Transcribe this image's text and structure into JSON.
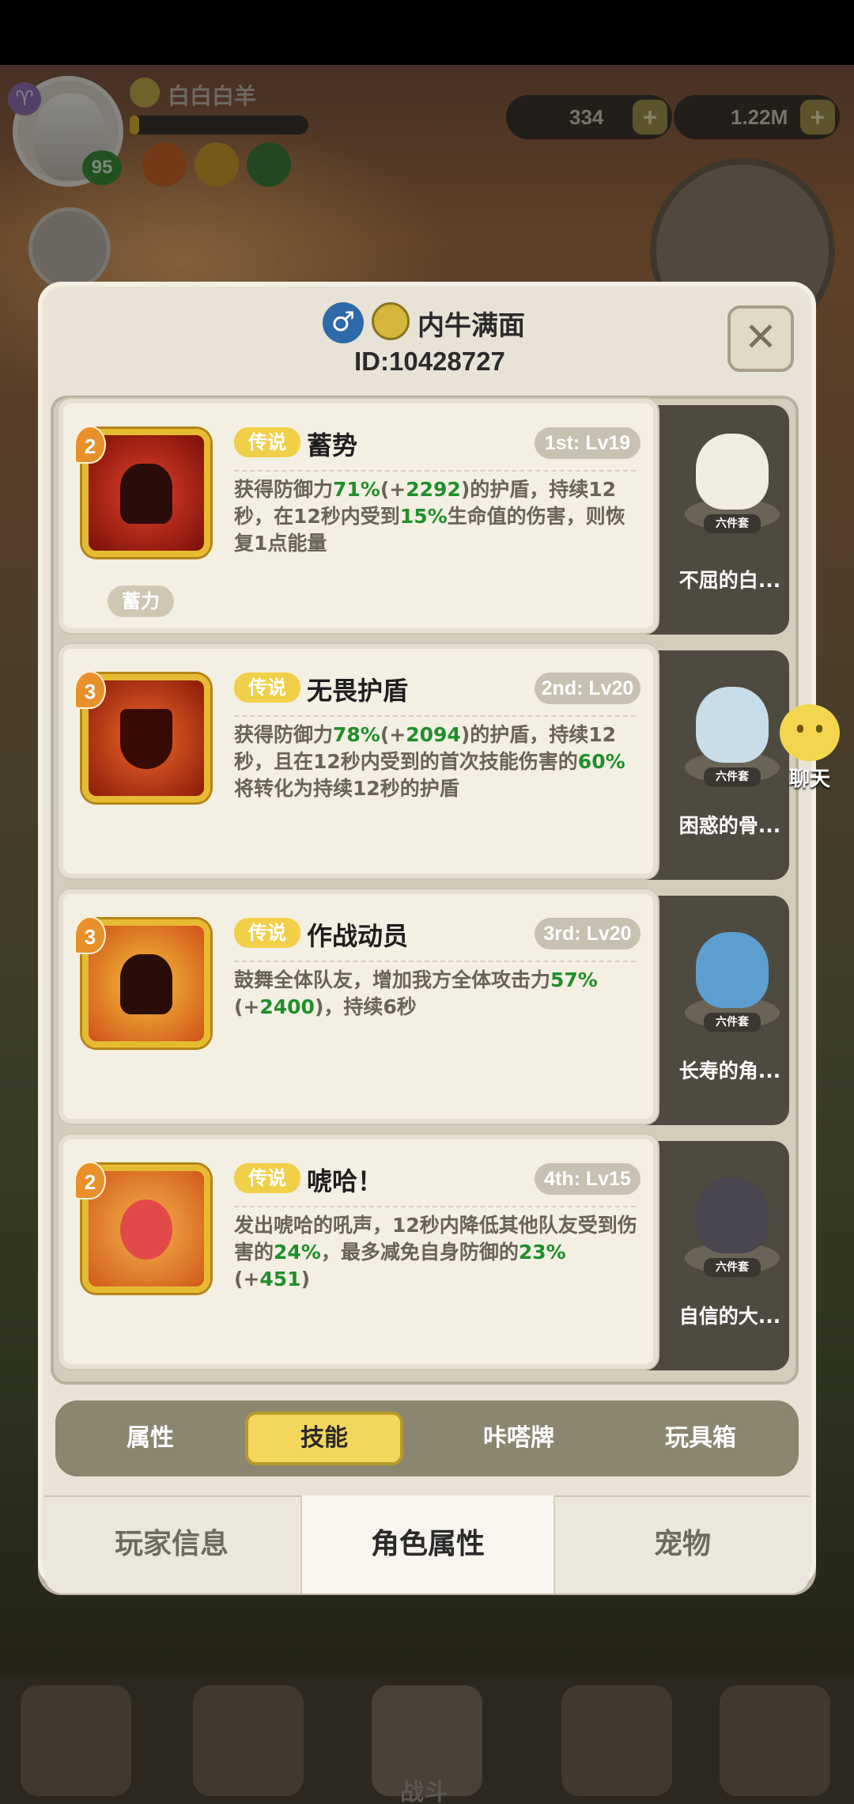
{
  "hud": {
    "player_name": "白白白羊",
    "level": "95",
    "currency1_value": "334",
    "currency2_value": "1.22M",
    "plus": "+"
  },
  "chat": {
    "label": "聊天"
  },
  "dialog": {
    "player_title": "内牛满面",
    "player_id": "ID:10428727",
    "gender_symbol": "♂",
    "close_glyph": "✕"
  },
  "skills": [
    {
      "rarity": "传说",
      "name": "蓄势",
      "slot": "1st: Lv19",
      "level_badge": "2",
      "tag": "蓄力",
      "desc_parts": [
        "获得防御力",
        "71%",
        "(+",
        "2292",
        ")的护盾，持续12秒，在12秒内受到",
        "15%",
        "生命值的伤害，则恢复1点能量"
      ]
    },
    {
      "rarity": "传说",
      "name": "无畏护盾",
      "slot": "2nd: Lv20",
      "level_badge": "3",
      "desc_parts": [
        "获得防御力",
        "78%",
        "(+",
        "2094",
        ")的护盾，持续12秒，且在12秒内受到的首次技能伤害的",
        "60%",
        "将转化为持续12秒的护盾"
      ]
    },
    {
      "rarity": "传说",
      "name": "作战动员",
      "slot": "3rd: Lv20",
      "level_badge": "3",
      "desc_parts": [
        "鼓舞全体队友，增加我方全体攻击力",
        "57%",
        "(+",
        "2400",
        ")，持续6秒"
      ]
    },
    {
      "rarity": "传说",
      "name": "唬哈！",
      "slot": "4th: Lv15",
      "level_badge": "2",
      "desc_parts": [
        "发出唬哈的吼声，12秒内降低其他队友受到伤害的",
        "24%",
        "，最多减免自身防御的",
        "23%",
        "(+",
        "451",
        ")"
      ]
    }
  ],
  "pets": [
    {
      "name": "不屈的白...",
      "badge": "六件套"
    },
    {
      "name": "困惑的骨...",
      "badge": "六件套"
    },
    {
      "name": "长寿的角...",
      "badge": "六件套"
    },
    {
      "name": "自信的大...",
      "badge": "六件套"
    }
  ],
  "tabs": [
    "属性",
    "技能",
    "咔嗒牌",
    "玩具箱"
  ],
  "active_tab": "技能",
  "bottom_tabs": [
    "玩家信息",
    "角色属性",
    "宠物"
  ],
  "active_bottom_tab": "角色属性",
  "nav": {
    "battle_label": "战斗"
  },
  "colors": {
    "green_value": "#1f8f2b",
    "legend_bg": "#f2cf48",
    "active_tab": "#f2d75c"
  }
}
